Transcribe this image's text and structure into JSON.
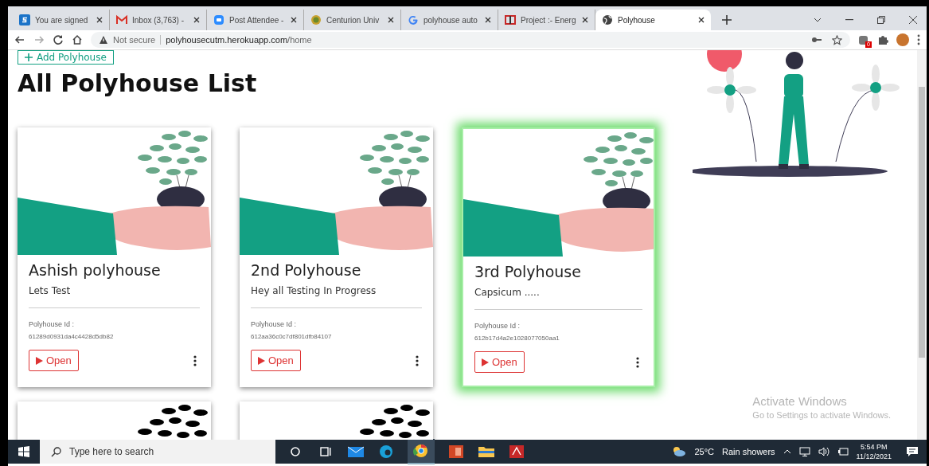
{
  "browser": {
    "tabs": [
      {
        "title": "You are signed",
        "kind": "s",
        "selected": false
      },
      {
        "title": "Inbox (3,763) -",
        "kind": "mail",
        "selected": false
      },
      {
        "title": "Post Attendee -",
        "kind": "meet",
        "selected": false
      },
      {
        "title": "Centurion Univ",
        "kind": "seal",
        "selected": false
      },
      {
        "title": "polyhouse auto",
        "kind": "google",
        "selected": false
      },
      {
        "title": "Project :- Energ",
        "kind": "project",
        "selected": false
      },
      {
        "title": "Polyhouse",
        "kind": "globe",
        "selected": true
      }
    ],
    "security": "Not secure",
    "url_host": "polyhousecutm.herokuapp.com",
    "url_path": "/home",
    "extension_badge": "0"
  },
  "page": {
    "add_button": "Add Polyhouse",
    "heading": "All Polyhouse List",
    "cards": [
      {
        "kind": "full",
        "title": "Ashish polyhouse",
        "description": "Lets Test",
        "id_label": "Polyhouse Id :",
        "id": "61289d0931da4c4428d5db82",
        "button": "Open",
        "highlighted": false
      },
      {
        "kind": "full",
        "title": "2nd Polyhouse",
        "description": "Hey all Testing In Progress",
        "id_label": "Polyhouse Id :",
        "id": "612aa36c0c7df801dfb84107",
        "button": "Open",
        "highlighted": false
      },
      {
        "kind": "full",
        "title": "3rd Polyhouse",
        "description": "Capsicum .....",
        "id_label": "Polyhouse Id :",
        "id": "612b17d4a2e1028077050aa1",
        "button": "Open",
        "highlighted": true
      },
      {
        "kind": "cut",
        "highlighted": false
      },
      {
        "kind": "cut",
        "highlighted": false
      }
    ]
  },
  "activation": {
    "title": "Activate Windows",
    "hint": "Go to Settings to activate Windows."
  },
  "taskbar": {
    "search_placeholder": "Type here to search",
    "temperature": "25°C",
    "weather": "Rain showers",
    "time": "5:54 PM",
    "date": "11/12/2021"
  }
}
